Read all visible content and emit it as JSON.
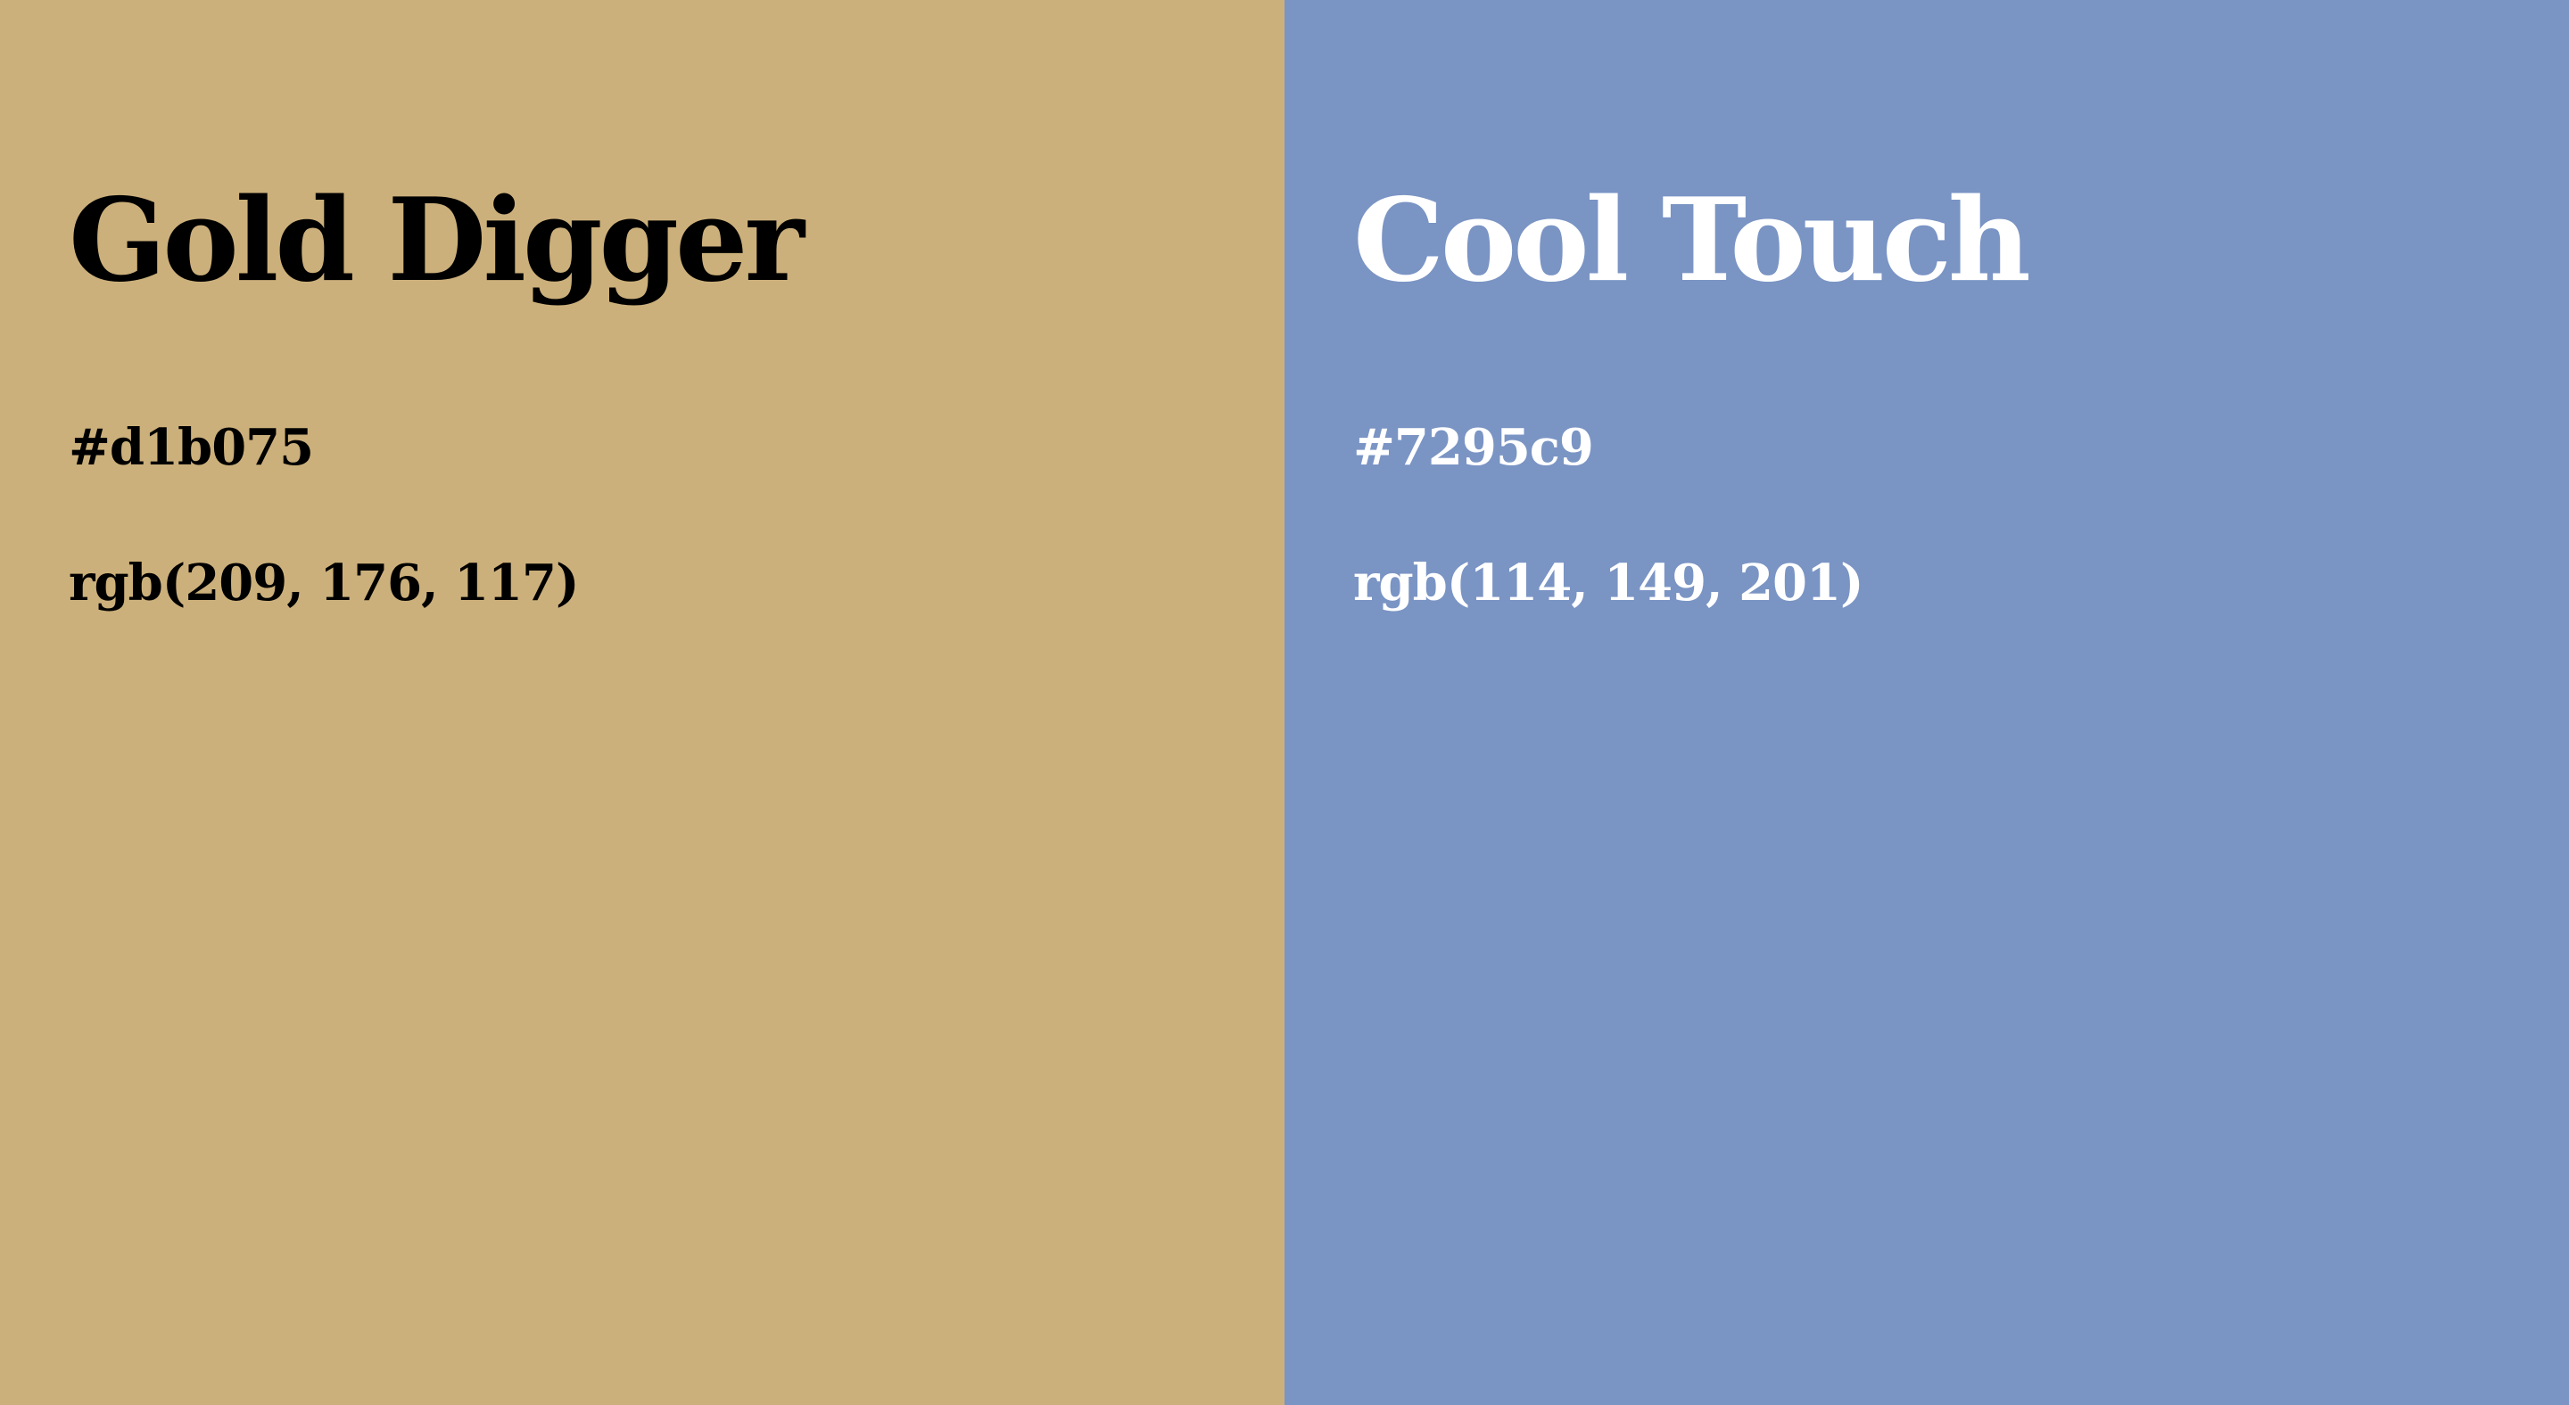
{
  "swatches": [
    {
      "name": "Gold Digger",
      "hex": "#d1b075",
      "rgb": "rgb(209, 176, 117)",
      "background": "#ccb07b",
      "text_color": "#000000"
    },
    {
      "name": "Cool Touch",
      "hex": "#7295c9",
      "rgb": "rgb(114, 149, 201)",
      "background": "#7a94c4",
      "text_color": "#ffffff"
    }
  ]
}
